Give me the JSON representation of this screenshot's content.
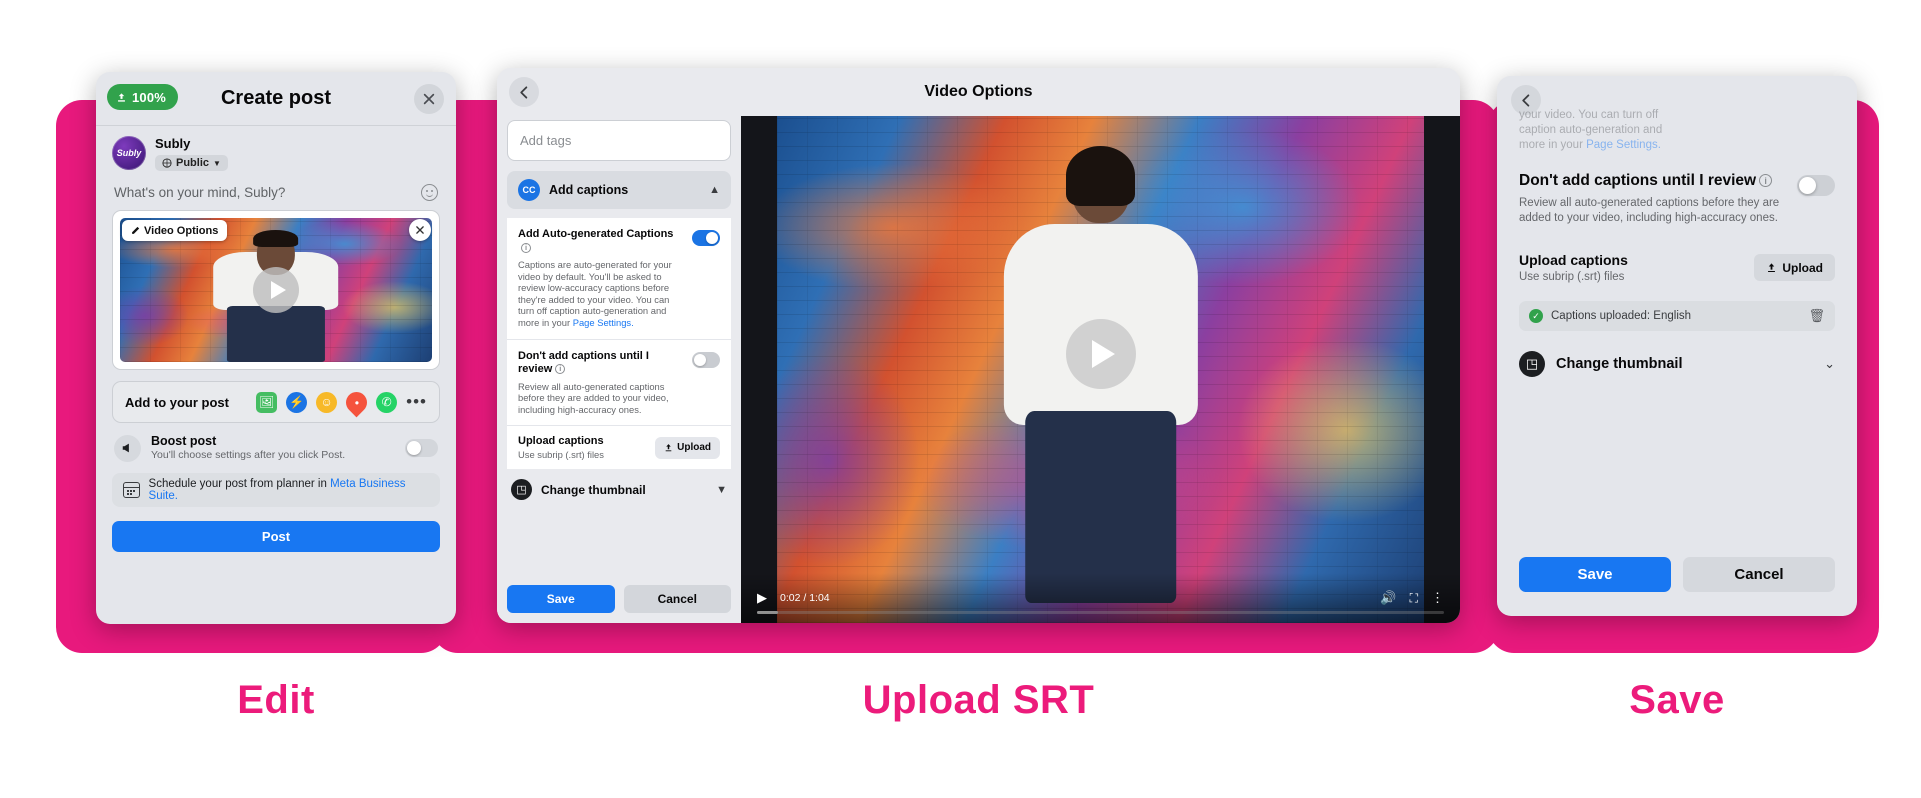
{
  "captions": {
    "edit": "Edit",
    "upload": "Upload SRT",
    "save": "Save"
  },
  "colors": {
    "brand_pink": "#EC1B7B",
    "facebook_blue": "#1877F2",
    "success_green": "#31A24C"
  },
  "panel_create_post": {
    "upload_badge": "100%",
    "title": "Create post",
    "close_icon": "close-icon",
    "user_name": "Subly",
    "avatar_text": "Subly",
    "privacy_label": "Public",
    "privacy_icon": "globe-icon",
    "placeholder": "What's on your mind, Subly?",
    "emoji_icon": "smiley-icon",
    "video_options_pill": "Video Options",
    "video_options_icon": "pencil-icon",
    "media_close_icon": "close-icon",
    "play_icon": "play-icon",
    "add_to_post_label": "Add to your post",
    "add_icons": [
      "photo-icon",
      "messenger-icon",
      "emoji-icon",
      "location-icon",
      "whatsapp-icon",
      "more-options-icon"
    ],
    "boost_title": "Boost post",
    "boost_subtitle": "You'll choose settings after you click Post.",
    "boost_icon": "megaphone-icon",
    "boost_toggle_state": "off",
    "schedule_text": "Schedule your post from planner in ",
    "schedule_link": "Meta Business Suite.",
    "schedule_icon": "calendar-icon",
    "post_button": "Post"
  },
  "panel_video_options": {
    "title": "Video Options",
    "back_icon": "back-arrow-icon",
    "tags_placeholder": "Add tags",
    "captions_section_label": "Add captions",
    "captions_section_icon": "cc-icon",
    "captions_chevron": "chevron-up-icon",
    "auto_captions_title": "Add Auto-generated Captions",
    "auto_captions_info_icon": "info-icon",
    "auto_captions_desc": "Captions are auto-generated for your video by default. You'll be asked to review low-accuracy captions before they're added to your video. You can turn off caption auto-generation and more in your ",
    "auto_captions_desc_link": "Page Settings.",
    "auto_captions_toggle_state": "on",
    "review_title": "Don't add captions until I review",
    "review_info_icon": "info-icon",
    "review_desc": "Review all auto-generated captions before they are added to your video, including high-accuracy ones.",
    "review_toggle_state": "off",
    "upload_captions_title": "Upload captions",
    "upload_captions_subtitle": "Use subrip (.srt) files",
    "upload_button": "Upload",
    "upload_button_icon": "upload-icon",
    "change_thumbnail_label": "Change thumbnail",
    "change_thumbnail_icon": "image-stack-icon",
    "change_thumbnail_chevron": "chevron-down-icon",
    "save_button": "Save",
    "cancel_button": "Cancel",
    "video": {
      "play_icon": "play-icon",
      "current_time": "0:02",
      "duration": "1:04",
      "time_display": "0:02 / 1:04",
      "volume_icon": "volume-icon",
      "fullscreen_icon": "fullscreen-icon",
      "more_icon": "more-vertical-icon",
      "progress_percent": 3
    }
  },
  "panel_save": {
    "back_icon": "back-arrow-icon",
    "faded_text_line1": "your video. You can turn off",
    "faded_text_line2": "caption auto-generation and",
    "faded_text_line3_prefix": "more in your ",
    "faded_text_link": "Page Settings.",
    "review_title": "Don't add captions until I review",
    "review_info_icon": "info-icon",
    "review_desc": "Review all auto-generated captions before they are added to your video, including high-accuracy ones.",
    "review_toggle_state": "off",
    "upload_captions_title": "Upload captions",
    "upload_captions_subtitle": "Use subrip (.srt) files",
    "upload_button": "Upload",
    "upload_button_icon": "upload-icon",
    "captions_uploaded_text": "Captions uploaded: English",
    "captions_uploaded_check_icon": "check-circle-icon",
    "captions_delete_icon": "trash-icon",
    "change_thumbnail_label": "Change thumbnail",
    "change_thumbnail_icon": "image-stack-icon",
    "change_thumbnail_chevron": "chevron-down-icon",
    "save_button": "Save",
    "cancel_button": "Cancel"
  }
}
